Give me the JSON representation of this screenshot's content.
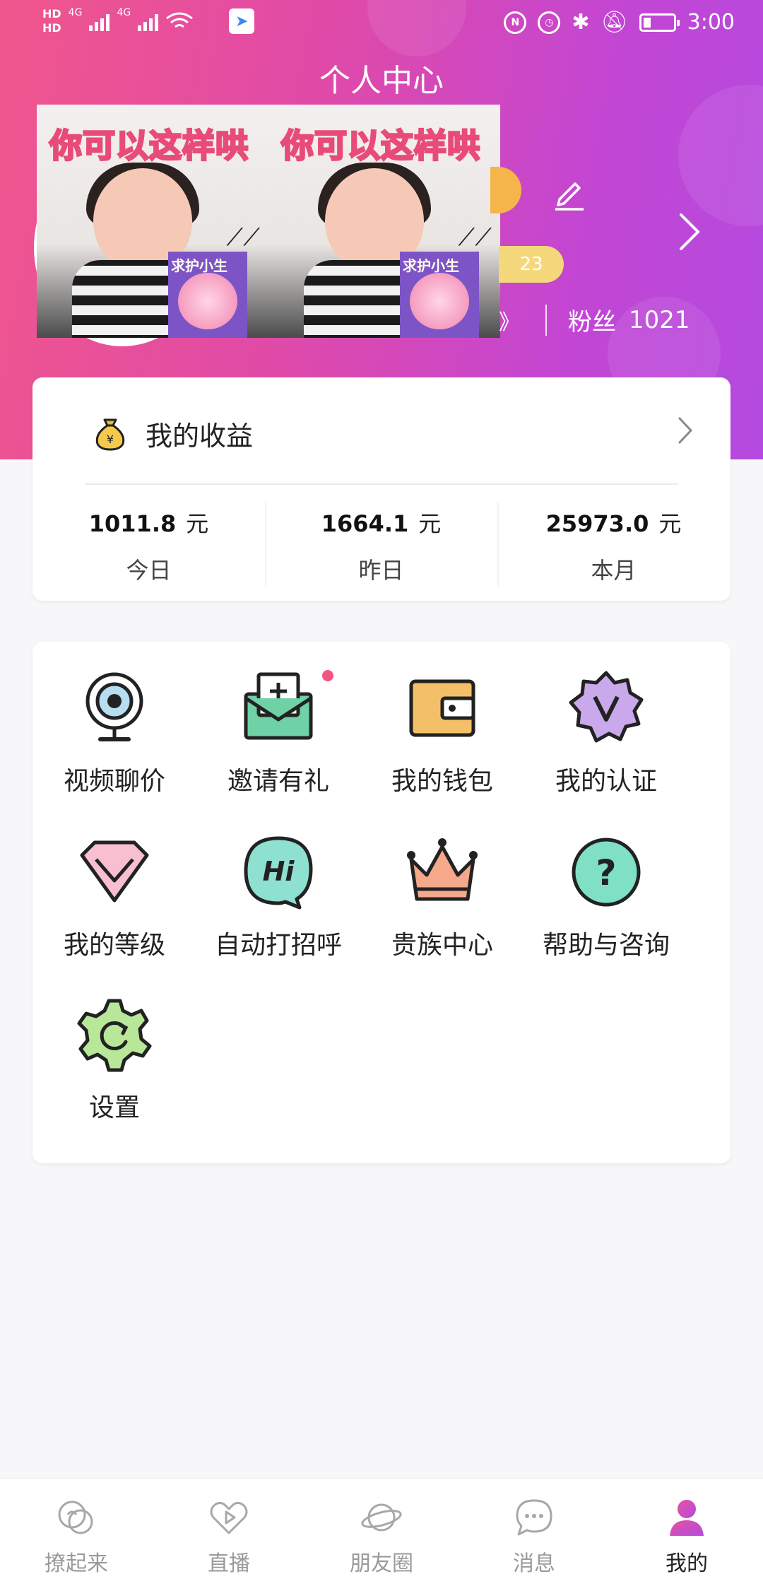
{
  "status_bar": {
    "hd1": "HD",
    "hd2": "HD",
    "net1": "4G",
    "net2": "4G",
    "time": "3:00"
  },
  "header": {
    "title": "个人中心",
    "meme_text_left": "你可以这样哄",
    "meme_text_right": "你可以这样哄",
    "meme_card_left": "求护小生",
    "meme_card_right": "求护小生",
    "level_badge": "23",
    "fans_label": "粉丝",
    "fans_count": "1021"
  },
  "earnings": {
    "title": "我的收益",
    "items": [
      {
        "value": "1011.8",
        "unit": "元",
        "label": "今日"
      },
      {
        "value": "1664.1",
        "unit": "元",
        "label": "昨日"
      },
      {
        "value": "25973.0",
        "unit": "元",
        "label": "本月"
      }
    ]
  },
  "menu": {
    "items": [
      {
        "label": "视频聊价",
        "icon": "camera-icon"
      },
      {
        "label": "邀请有礼",
        "icon": "invite-mail-icon"
      },
      {
        "label": "我的钱包",
        "icon": "wallet-icon"
      },
      {
        "label": "我的认证",
        "icon": "verified-badge-icon"
      },
      {
        "label": "我的等级",
        "icon": "diamond-level-icon"
      },
      {
        "label": "自动打招呼",
        "icon": "hi-bubble-icon"
      },
      {
        "label": "贵族中心",
        "icon": "crown-icon"
      },
      {
        "label": "帮助与咨询",
        "icon": "help-icon"
      },
      {
        "label": "设置",
        "icon": "settings-gear-icon"
      }
    ]
  },
  "tabbar": {
    "items": [
      {
        "label": "撩起来",
        "icon": "chat-bubbles-icon"
      },
      {
        "label": "直播",
        "icon": "heart-play-icon"
      },
      {
        "label": "朋友圈",
        "icon": "planet-icon"
      },
      {
        "label": "消息",
        "icon": "message-icon"
      },
      {
        "label": "我的",
        "icon": "profile-icon"
      }
    ],
    "active": "我的"
  },
  "colors": {
    "header_gradient_start": "#f0568c",
    "header_gradient_end": "#b44ae0",
    "badge_yellow": "#f5d77c",
    "notification_dot": "#f2557f"
  }
}
